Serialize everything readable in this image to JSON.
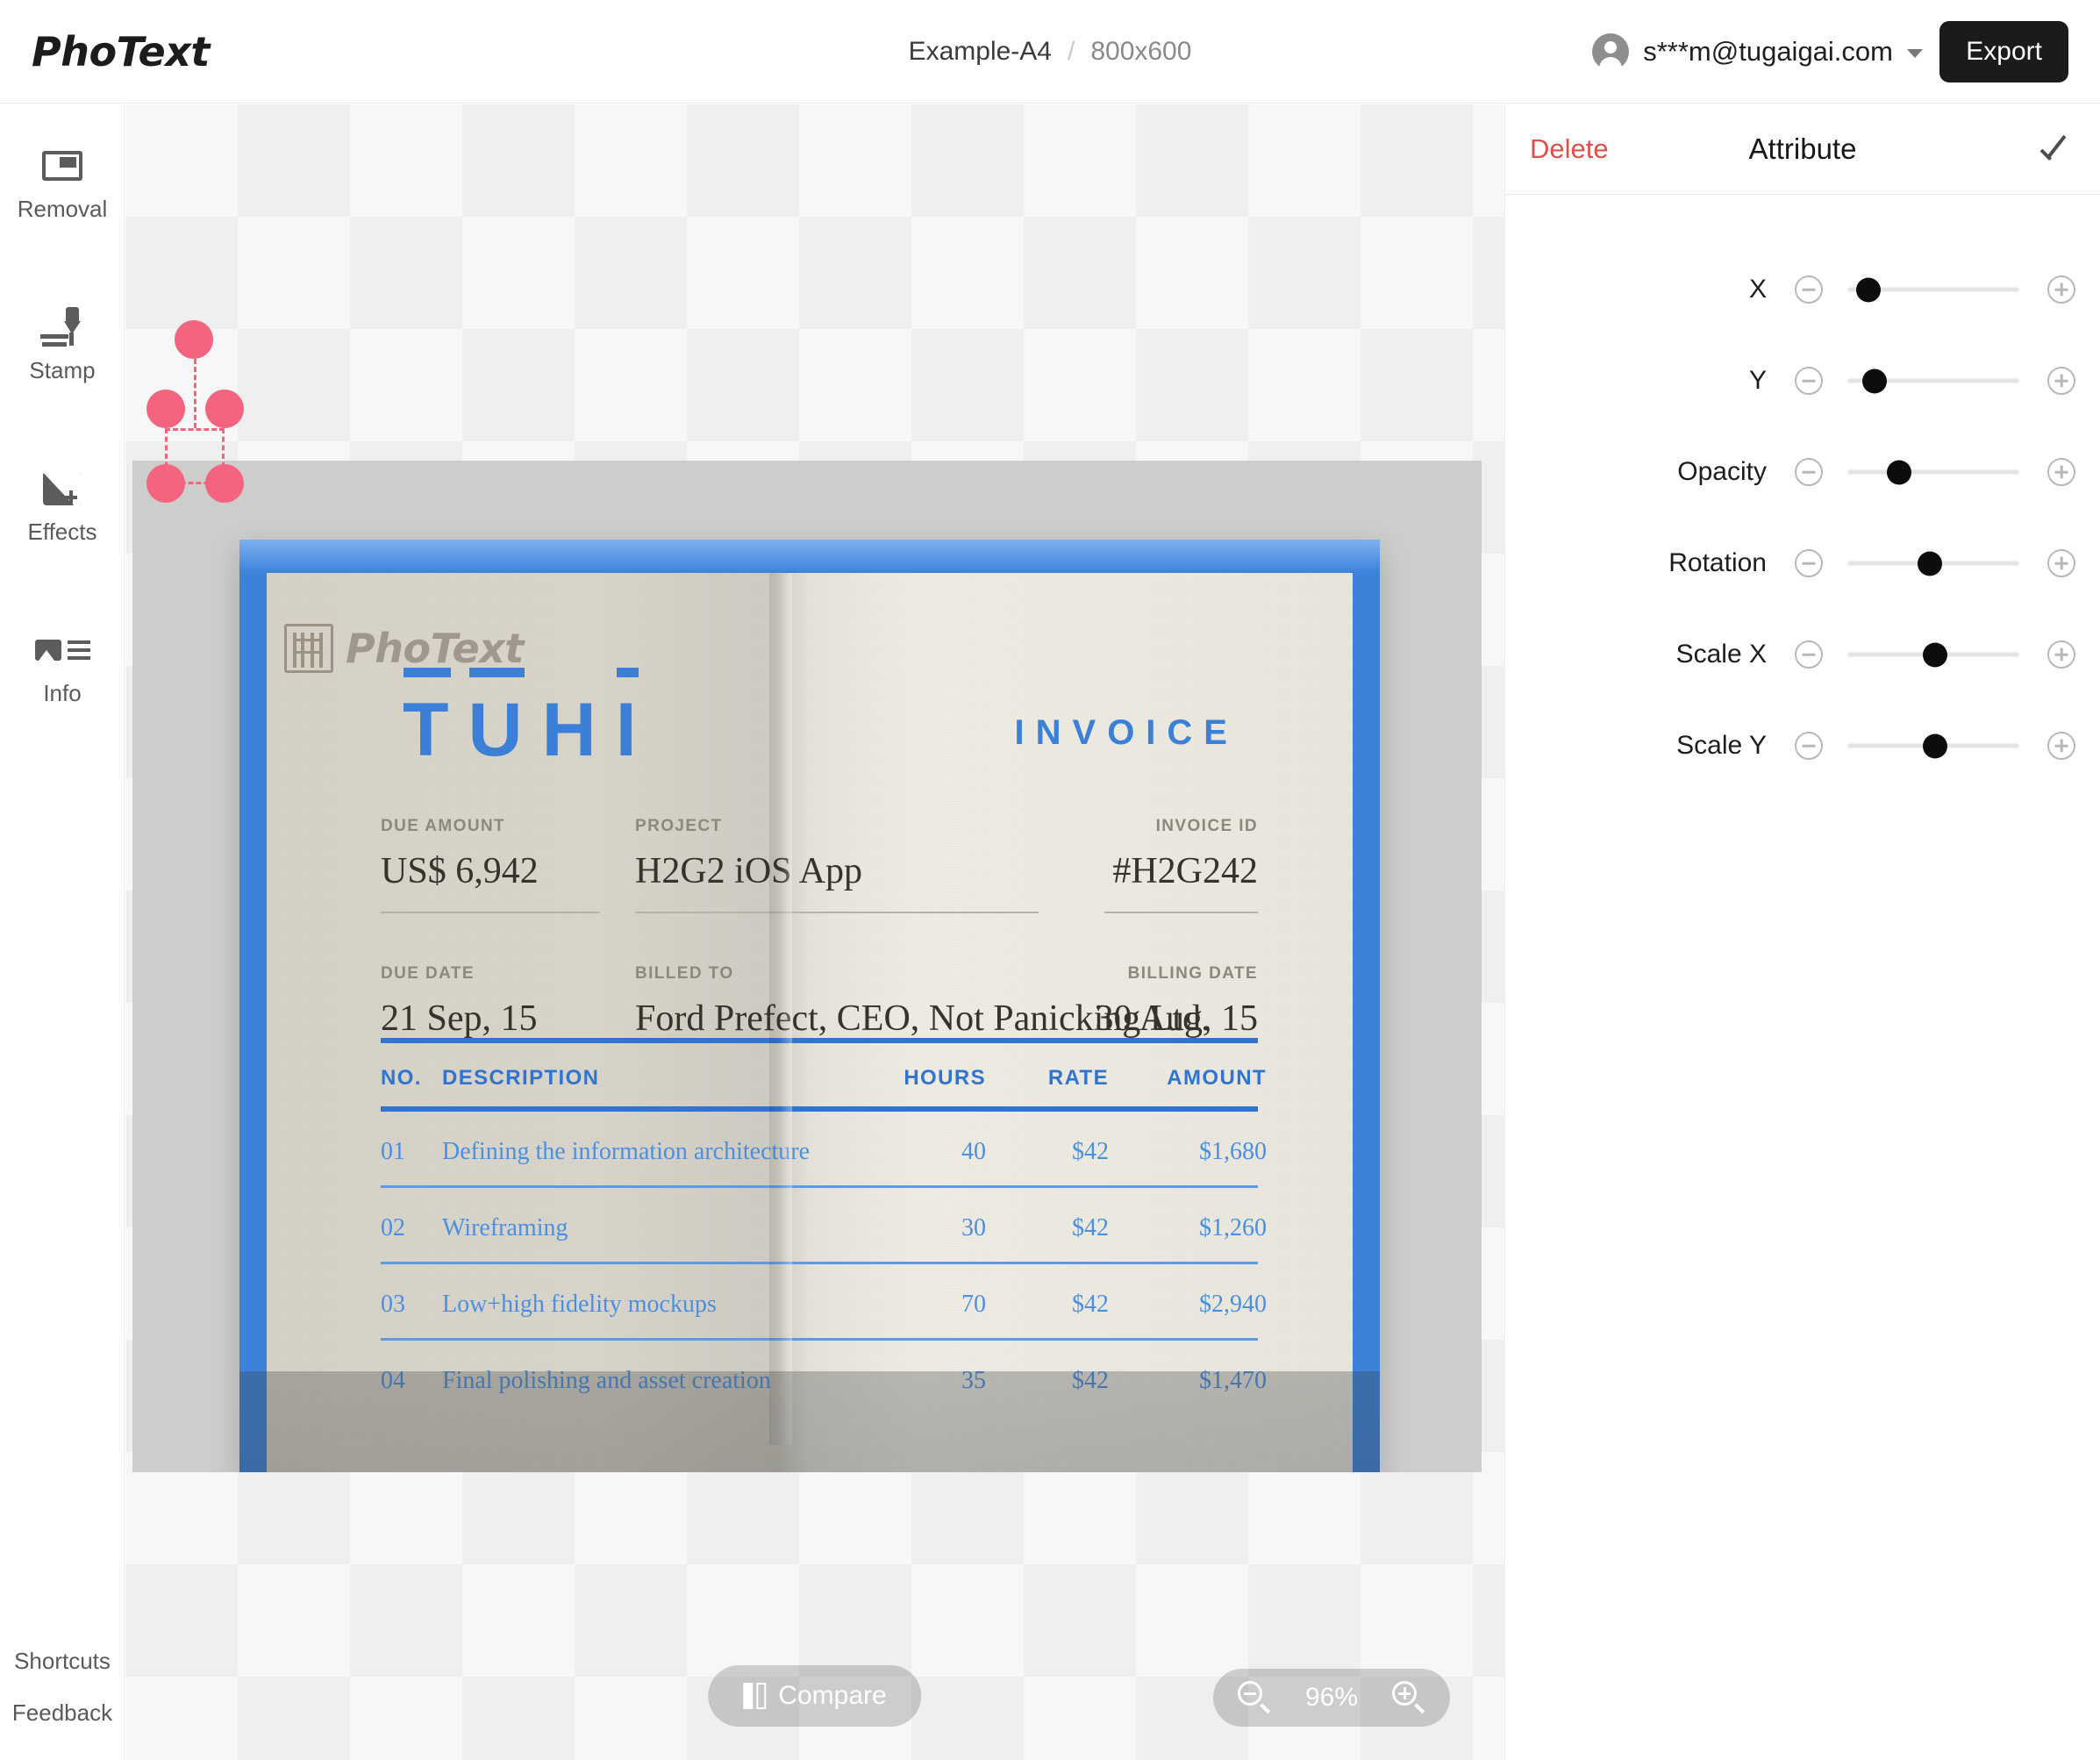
{
  "app": {
    "logo": "PhoText",
    "accent_red": "#e0504a",
    "selection_color": "#f4647e",
    "export_bg": "#1b1b1b"
  },
  "header": {
    "doc_name": "Example-A4",
    "separator": "/",
    "dimensions": "800x600",
    "account_email": "s***m@tugaigai.com",
    "export_label": "Export"
  },
  "sidebar": {
    "tools": [
      {
        "icon": "removal-icon",
        "label": "Removal"
      },
      {
        "icon": "stamp-icon",
        "label": "Stamp"
      },
      {
        "icon": "effects-icon",
        "label": "Effects"
      },
      {
        "icon": "info-icon",
        "label": "Info"
      }
    ],
    "bottom_links": [
      {
        "label": "Shortcuts"
      },
      {
        "label": "Feedback"
      }
    ]
  },
  "canvas": {
    "compare_label": "Compare",
    "zoom_level": "96%",
    "stamp_overlay": {
      "text": "PhoText",
      "seal_icon": "seal-stamp-icon"
    }
  },
  "document": {
    "brand": "TUHI",
    "brand_letters": [
      "T",
      "U",
      "H",
      "I"
    ],
    "title": "INVOICE",
    "meta": [
      {
        "key": "DUE AMOUNT",
        "value": "US$ 6,942"
      },
      {
        "key": "PROJECT",
        "value": "H2G2 iOS App"
      },
      {
        "key": "INVOICE ID",
        "value": "#H2G242"
      },
      {
        "key": "DUE DATE",
        "value": "21 Sep, 15"
      },
      {
        "key": "BILLED TO",
        "value": "Ford Prefect, CEO, Not Panicking Ltd."
      },
      {
        "key": "BILLING DATE",
        "value": "30 Aug, 15"
      }
    ],
    "table": {
      "columns": [
        "NO.",
        "DESCRIPTION",
        "HOURS",
        "RATE",
        "AMOUNT"
      ],
      "rows": [
        {
          "no": "01",
          "description": "Defining the information architecture",
          "hours": "40",
          "rate": "$42",
          "amount": "$1,680"
        },
        {
          "no": "02",
          "description": "Wireframing",
          "hours": "30",
          "rate": "$42",
          "amount": "$1,260"
        },
        {
          "no": "03",
          "description": "Low+high fidelity mockups",
          "hours": "70",
          "rate": "$42",
          "amount": "$2,940"
        },
        {
          "no": "04",
          "description": "Final polishing and asset creation",
          "hours": "35",
          "rate": "$42",
          "amount": "$1,470"
        }
      ]
    }
  },
  "panel": {
    "delete_label": "Delete",
    "title": "Attribute",
    "confirm_icon": "check-icon",
    "sliders": [
      {
        "label": "X",
        "percent": 12
      },
      {
        "label": "Y",
        "percent": 16
      },
      {
        "label": "Opacity",
        "percent": 30
      },
      {
        "label": "Rotation",
        "percent": 48
      },
      {
        "label": "Scale X",
        "percent": 51
      },
      {
        "label": "Scale Y",
        "percent": 51
      }
    ]
  }
}
